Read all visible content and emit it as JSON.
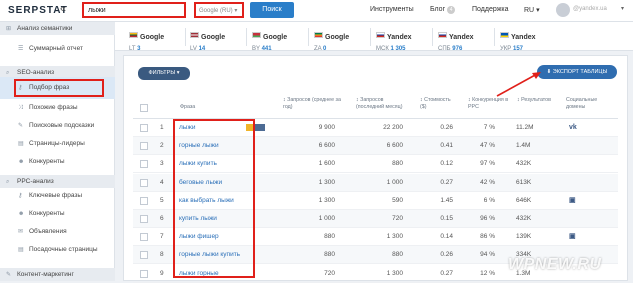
{
  "header": {
    "logo": "SERPSTAT",
    "search_value": "лыжи",
    "db_select": "Google (RU)",
    "search_button": "Поиск",
    "nav": [
      "Инструменты",
      "Блог",
      "Поддержка",
      "RU"
    ],
    "blog_badge": "4",
    "user_email": "@yandex.ua"
  },
  "sidebar": {
    "sections": [
      "Анализ семантики",
      "SEO-анализ",
      "PPC-анализ",
      "Контент-маркетинг"
    ],
    "items": {
      "summary": "Суммарный отчет",
      "phrase_selection": "Подбор фраз",
      "similar": "Похожие фразы",
      "suggestions": "Поисковые подсказки",
      "leaders": "Страницы-лидеры",
      "competitors": "Конкуренты",
      "ppc_keywords": "Ключевые фразы",
      "ppc_competitors": "Конкуренты",
      "ads": "Объявления",
      "landing": "Посадочные страницы"
    }
  },
  "databases": [
    {
      "name": "Google",
      "code": "LT",
      "count": "3",
      "flag": [
        "#fdb913",
        "#006a44",
        "#c1272d"
      ]
    },
    {
      "name": "Google",
      "code": "LV",
      "count": "14",
      "flag": [
        "#9e3039",
        "#ffffff",
        "#9e3039"
      ]
    },
    {
      "name": "Google",
      "code": "BY",
      "count": "441",
      "flag": [
        "#c8313e",
        "#c8313e",
        "#4aa657"
      ]
    },
    {
      "name": "Google",
      "code": "ZA",
      "count": "0",
      "flag": [
        "#007a4d",
        "#ffb612",
        "#de3831"
      ]
    },
    {
      "name": "Yandex",
      "code": "МСК",
      "count": "1 305",
      "flag": [
        "#ffffff",
        "#0039a6",
        "#d52b1e"
      ]
    },
    {
      "name": "Yandex",
      "code": "СПБ",
      "count": "976",
      "flag": [
        "#ffffff",
        "#0039a6",
        "#d52b1e"
      ]
    },
    {
      "name": "Yandex",
      "code": "УКР",
      "count": "157",
      "flag": [
        "#0057b7",
        "#0057b7",
        "#ffd700"
      ]
    }
  ],
  "toolbar": {
    "filters": "ФИЛЬТРЫ",
    "export": "ЭКСПОРТ ТАБЛИЦЫ"
  },
  "table": {
    "headers": {
      "phrase": "Фраза",
      "queries_avg": "Запросов (среднее за год)",
      "queries_last": "Запросов (последний месяц)",
      "cost": "Стоимость ($)",
      "competition": "Конкуренция в PPC",
      "results": "Результатов",
      "social": "Социальные домены"
    },
    "rows": [
      {
        "n": "1",
        "phrase": "лыжи",
        "avg": "9 900",
        "last": "22 200",
        "cost": "0.26",
        "comp": "7 %",
        "results": "11.2M",
        "social": "vk",
        "features": true
      },
      {
        "n": "2",
        "phrase": "горные лыжи",
        "avg": "6 600",
        "last": "6 600",
        "cost": "0.41",
        "comp": "47 %",
        "results": "1.4M",
        "social": "",
        "features": false
      },
      {
        "n": "3",
        "phrase": "лыжи купить",
        "avg": "1 600",
        "last": "880",
        "cost": "0.12",
        "comp": "97 %",
        "results": "432K",
        "social": "",
        "features": false
      },
      {
        "n": "4",
        "phrase": "беговые лыжи",
        "avg": "1 300",
        "last": "1 000",
        "cost": "0.27",
        "comp": "42 %",
        "results": "613K",
        "social": "",
        "features": false
      },
      {
        "n": "5",
        "phrase": "как выбрать лыжи",
        "avg": "1 300",
        "last": "590",
        "cost": "1.45",
        "comp": "6 %",
        "results": "646K",
        "social": "yt",
        "features": false
      },
      {
        "n": "6",
        "phrase": "купить лыжи",
        "avg": "1 000",
        "last": "720",
        "cost": "0.15",
        "comp": "96 %",
        "results": "432K",
        "social": "",
        "features": false
      },
      {
        "n": "7",
        "phrase": "лыжи фишер",
        "avg": "880",
        "last": "1 300",
        "cost": "0.14",
        "comp": "86 %",
        "results": "139K",
        "social": "yt",
        "features": false
      },
      {
        "n": "8",
        "phrase": "горные лыжи купить",
        "avg": "880",
        "last": "880",
        "cost": "0.26",
        "comp": "94 %",
        "results": "334K",
        "social": "",
        "features": false
      },
      {
        "n": "9",
        "phrase": "лыжи горные",
        "avg": "720",
        "last": "1 300",
        "cost": "0.27",
        "comp": "12 %",
        "results": "1.3M",
        "social": "",
        "features": false
      }
    ]
  },
  "watermark": "WPNEW.RU",
  "colors": {
    "accent": "#2a7ec9",
    "highlight": "#e0201a",
    "link": "#2a6fb8"
  }
}
